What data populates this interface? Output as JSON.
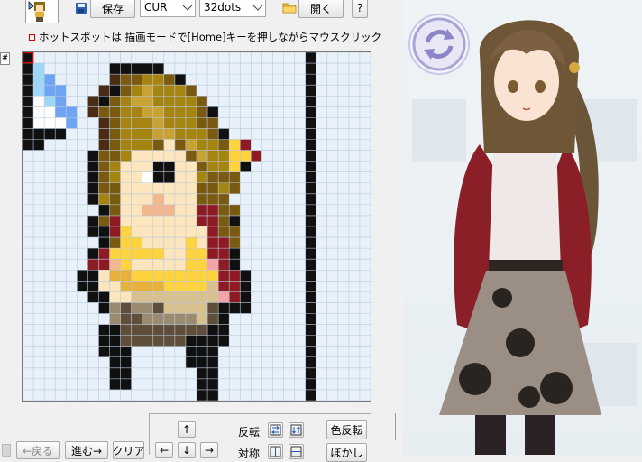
{
  "toolbar": {
    "save_label": "保存",
    "format_value": "CUR",
    "size_value": "32dots",
    "open_label": "開く",
    "help_label": "?"
  },
  "hint": {
    "text": "ホットスポットは 描画モードで[Home]キーを押しながらマウスクリック"
  },
  "grid_toggle_label": "#",
  "controls": {
    "flip_label": "反転",
    "symmetric_label": "対称",
    "color_invert_label": "色反転",
    "blur_label": "ぼかし",
    "back_label": "←戻る",
    "redo_label": "進む→",
    "clear_label": "クリア",
    "up_arrow": "↑",
    "left_arrow": "←",
    "down_arrow": "↓",
    "right_arrow": "→",
    "flip_horizontal_icon": "flip-horizontal-icon",
    "flip_vertical_icon": "flip-vertical-icon"
  },
  "colors": {
    "grid_bg": "#e8f1fa",
    "grid_line": "#b7c8da",
    "hair_brown": "#7d5a12",
    "hair_gold": "#b8860b",
    "skin": "#fde0b0",
    "dark_red": "#8b1a1a",
    "cursor_blue": "#5a9af0",
    "accent_yellow": "#ffd21f"
  },
  "pixel_art": {
    "size": 32,
    "palette": {
      "K": "#101010",
      "W": "#ffffff",
      "B": "#6fa4f2",
      "L": "#9fd8f6",
      "D": "#4b2b14",
      "H": "#7a5a10",
      "G": "#a68412",
      "Y": "#c9a234",
      "S": "#fde6bd",
      "P": "#f3b68e",
      "R": "#8e1b24",
      "O": "#e7b13b",
      "U": "#ffd33d",
      "T": "#d9c08f",
      "N": "#9a8a70",
      "E": "#5e4e3a",
      "C": "#f4a4a4"
    },
    "rows": [
      "K.........................K.....",
      "KL......KKKKK.............K.....",
      "KLB.....DHHGGHK...........K.....",
      "KLBB...DKHGYGGGH..........K.....",
      "KWLB..DKHGYYGGGGH.........K.....",
      "KWWBB.DHHGGYYGGGHK........K.....",
      "KWWWB..DHGGGYGGGHH........K.....",
      "KKKK...DHGGGYYGGGHK.......K.....",
      "KK.....DHGGGHSHYGGHUR.....K.....",
      "......KHHGSSSSSHYGGUUR....K.....",
      "......KHGSSSKKSSHGGUK.....K.....",
      "......KHGSSWKKSSGHHH......K.....",
      "......KHHSSSSSSSHHGH......K.....",
      "......KGHSSSPSSSHHH.......K.....",
      ".......KHSSPPPSSRRHH......K.....",
      "......KHRSSSSSSSRRHK......K.....",
      "......KKRUSSSSSSSRHH......K.....",
      ".......KHUUSSSSUSRRH......K.....",
      "......KRUUUUUSSUURRK......K.....",
      "......RRPUSSSSSUUCRK......K.....",
      ".....KKSOOUUUUUUUURRK.....K.....",
      ".....KKSSOOOOUUUUTRRK.....K.....",
      "......KKSSTTTTTTTTCRK.....K.....",
      ".......KNENNETTTTEKKK.....K.....",
      "........NEENNNNNTEK.......K.....",
      ".......KKEEEEEEEEKK.......K.....",
      ".......KKEEEEEEKKKK.......K.....",
      ".......KKK.....KKK........K.....",
      "........KK.....KKK........K.....",
      "........KK......KK........K.....",
      "........KK......KK........K.....",
      "................KK........K....."
    ]
  }
}
